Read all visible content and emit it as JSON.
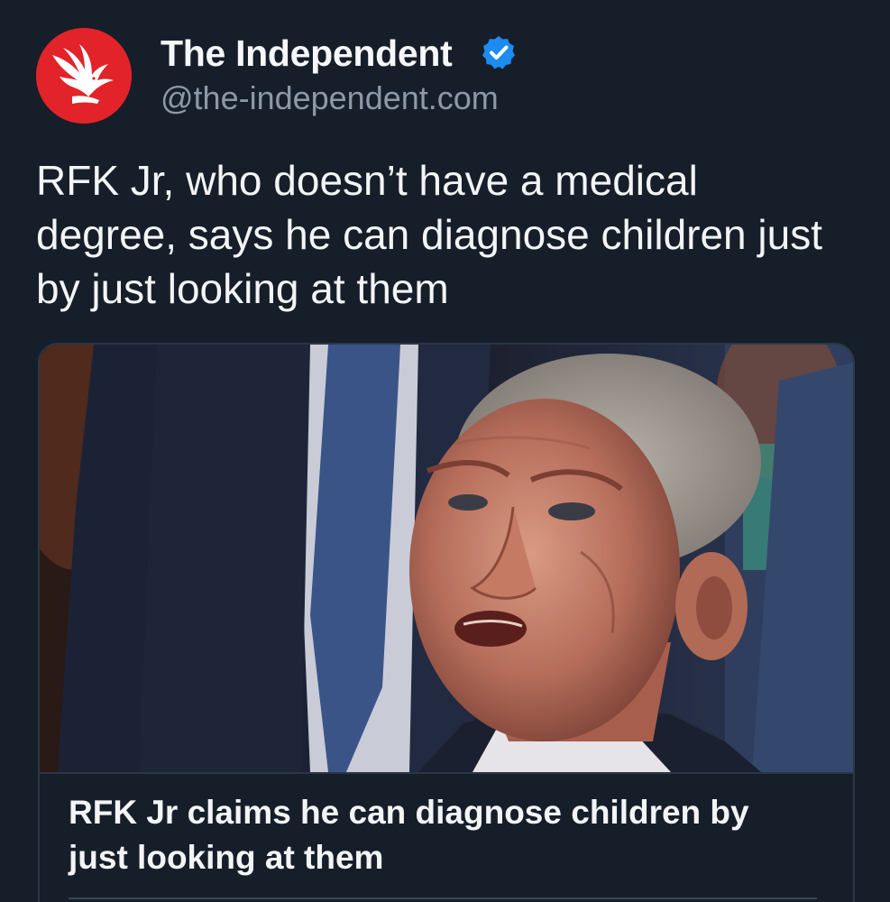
{
  "post": {
    "author": {
      "name": "The Independent",
      "handle": "@the-independent.com",
      "verified": true,
      "avatar_icon": "eagle-logo-icon",
      "avatar_color": "#e2232a"
    },
    "text": "RFK Jr, who doesn’t have a medical degree, says he can diagnose children just by just looking at them",
    "link_card": {
      "title": "RFK Jr claims he can diagnose children by just looking at them",
      "image": "photo of an older man with grey hair in a dark suit, looking upward"
    }
  },
  "colors": {
    "background": "#161e29",
    "verified_badge": "#1d8cf0",
    "handle_text": "#8d99a8",
    "card_border": "#2b3747"
  }
}
